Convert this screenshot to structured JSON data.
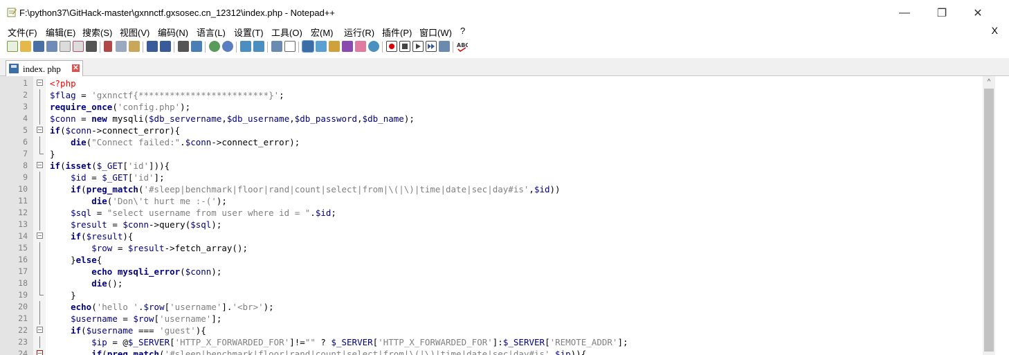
{
  "window": {
    "title": "F:\\python37\\GitHack-master\\gxnnctf.gxsosec.cn_12312\\index.php - Notepad++",
    "minimize": "—",
    "restore": "❐",
    "close": "✕"
  },
  "menu": {
    "items": [
      "文件(F)",
      "编辑(E)",
      "搜索(S)",
      "视图(V)",
      "编码(N)",
      "语言(L)",
      "设置(T)",
      "工具(O)",
      "宏(M)",
      "运行(R)",
      "插件(P)",
      "窗口(W)",
      "?"
    ],
    "close_doc": "X"
  },
  "toolbar": {
    "icons": [
      "new-file",
      "open-file",
      "save",
      "save-all",
      "close",
      "close-all",
      "print",
      "cut",
      "copy",
      "paste",
      "undo",
      "redo",
      "find",
      "replace",
      "zoom-in",
      "zoom-out",
      "sync-vertical",
      "sync-horizontal",
      "word-wrap",
      "show-all-chars",
      "indent-guide",
      "doc-map",
      "function-list",
      "folder-workspace",
      "monitor",
      "record-macro",
      "stop-record",
      "play-macro",
      "run-macro-multiple",
      "save-macro",
      "spell-check"
    ]
  },
  "tab": {
    "label": "index. php",
    "close": "✕"
  },
  "editor": {
    "lines": [
      {
        "n": "1",
        "fold": "box",
        "parts": [
          [
            "r",
            "<?php"
          ]
        ]
      },
      {
        "n": "2",
        "fold": "vline",
        "parts": [
          [
            "v",
            "$flag"
          ],
          [
            "d",
            " = "
          ],
          [
            "s",
            "'gxnnctf{*************************}'"
          ],
          [
            "d",
            ";"
          ]
        ]
      },
      {
        "n": "3",
        "fold": "vline",
        "parts": [
          [
            "k",
            "require_once"
          ],
          [
            "d",
            "("
          ],
          [
            "s",
            "'config.php'"
          ],
          [
            "d",
            ");"
          ]
        ]
      },
      {
        "n": "4",
        "fold": "vline",
        "parts": [
          [
            "v",
            "$conn"
          ],
          [
            "d",
            " = "
          ],
          [
            "k",
            "new"
          ],
          [
            "d",
            " mysqli("
          ],
          [
            "v",
            "$db_servername"
          ],
          [
            "d",
            ","
          ],
          [
            "v",
            "$db_username"
          ],
          [
            "d",
            ","
          ],
          [
            "v",
            "$db_password"
          ],
          [
            "d",
            ","
          ],
          [
            "v",
            "$db_name"
          ],
          [
            "d",
            ");"
          ]
        ]
      },
      {
        "n": "5",
        "fold": "box",
        "parts": [
          [
            "k",
            "if"
          ],
          [
            "d",
            "("
          ],
          [
            "v",
            "$conn"
          ],
          [
            "d",
            "->connect_error){"
          ]
        ]
      },
      {
        "n": "6",
        "fold": "vline",
        "parts": [
          [
            "d",
            "    "
          ],
          [
            "k",
            "die"
          ],
          [
            "d",
            "("
          ],
          [
            "s",
            "\"Connect failed:\""
          ],
          [
            "d",
            "."
          ],
          [
            "v",
            "$conn"
          ],
          [
            "d",
            "->connect_error);"
          ]
        ]
      },
      {
        "n": "7",
        "fold": "end",
        "parts": [
          [
            "d",
            "}"
          ]
        ]
      },
      {
        "n": "8",
        "fold": "box",
        "parts": [
          [
            "k",
            "if"
          ],
          [
            "d",
            "("
          ],
          [
            "k",
            "isset"
          ],
          [
            "d",
            "("
          ],
          [
            "v",
            "$_GET"
          ],
          [
            "d",
            "["
          ],
          [
            "s",
            "'id'"
          ],
          [
            "d",
            "])){"
          ]
        ]
      },
      {
        "n": "9",
        "fold": "vline",
        "parts": [
          [
            "d",
            "    "
          ],
          [
            "v",
            "$id"
          ],
          [
            "d",
            " = "
          ],
          [
            "v",
            "$_GET"
          ],
          [
            "d",
            "["
          ],
          [
            "s",
            "'id'"
          ],
          [
            "d",
            "];"
          ]
        ]
      },
      {
        "n": "10",
        "fold": "vline",
        "parts": [
          [
            "d",
            "    "
          ],
          [
            "k",
            "if"
          ],
          [
            "d",
            "("
          ],
          [
            "k",
            "preg_match"
          ],
          [
            "d",
            "("
          ],
          [
            "s",
            "'#sleep|benchmark|floor|rand|count|select|from|\\(|\\)|time|date|sec|day#is'"
          ],
          [
            "d",
            ","
          ],
          [
            "v",
            "$id"
          ],
          [
            "d",
            "))"
          ]
        ]
      },
      {
        "n": "11",
        "fold": "vline",
        "parts": [
          [
            "d",
            "        "
          ],
          [
            "k",
            "die"
          ],
          [
            "d",
            "("
          ],
          [
            "s",
            "'Don\\'t hurt me :-('"
          ],
          [
            "d",
            ");"
          ]
        ]
      },
      {
        "n": "12",
        "fold": "vline",
        "parts": [
          [
            "d",
            "    "
          ],
          [
            "v",
            "$sql"
          ],
          [
            "d",
            " = "
          ],
          [
            "s",
            "\"select username from user where id = \""
          ],
          [
            "d",
            "."
          ],
          [
            "v",
            "$id"
          ],
          [
            "d",
            ";"
          ]
        ]
      },
      {
        "n": "13",
        "fold": "vline",
        "parts": [
          [
            "d",
            "    "
          ],
          [
            "v",
            "$result"
          ],
          [
            "d",
            " = "
          ],
          [
            "v",
            "$conn"
          ],
          [
            "d",
            "->query("
          ],
          [
            "v",
            "$sql"
          ],
          [
            "d",
            ");"
          ]
        ]
      },
      {
        "n": "14",
        "fold": "box",
        "parts": [
          [
            "d",
            "    "
          ],
          [
            "k",
            "if"
          ],
          [
            "d",
            "("
          ],
          [
            "v",
            "$result"
          ],
          [
            "d",
            "){"
          ]
        ]
      },
      {
        "n": "15",
        "fold": "vline",
        "parts": [
          [
            "d",
            "        "
          ],
          [
            "v",
            "$row"
          ],
          [
            "d",
            " = "
          ],
          [
            "v",
            "$result"
          ],
          [
            "d",
            "->fetch_array();"
          ]
        ]
      },
      {
        "n": "16",
        "fold": "vline",
        "parts": [
          [
            "d",
            "    }"
          ],
          [
            "k",
            "else"
          ],
          [
            "d",
            "{"
          ]
        ]
      },
      {
        "n": "17",
        "fold": "vline",
        "parts": [
          [
            "d",
            "        "
          ],
          [
            "k",
            "echo"
          ],
          [
            "d",
            " "
          ],
          [
            "k",
            "mysqli_error"
          ],
          [
            "d",
            "("
          ],
          [
            "v",
            "$conn"
          ],
          [
            "d",
            ");"
          ]
        ]
      },
      {
        "n": "18",
        "fold": "vline",
        "parts": [
          [
            "d",
            "        "
          ],
          [
            "k",
            "die"
          ],
          [
            "d",
            "();"
          ]
        ]
      },
      {
        "n": "19",
        "fold": "end",
        "parts": [
          [
            "d",
            "    }"
          ]
        ]
      },
      {
        "n": "20",
        "fold": "vline",
        "parts": [
          [
            "d",
            "    "
          ],
          [
            "k",
            "echo"
          ],
          [
            "d",
            "("
          ],
          [
            "s",
            "'hello '"
          ],
          [
            "d",
            "."
          ],
          [
            "v",
            "$row"
          ],
          [
            "d",
            "["
          ],
          [
            "s",
            "'username'"
          ],
          [
            "d",
            "]."
          ],
          [
            "s",
            "'<br>'"
          ],
          [
            "d",
            ");"
          ]
        ]
      },
      {
        "n": "21",
        "fold": "vline",
        "parts": [
          [
            "d",
            "    "
          ],
          [
            "v",
            "$username"
          ],
          [
            "d",
            " = "
          ],
          [
            "v",
            "$row"
          ],
          [
            "d",
            "["
          ],
          [
            "s",
            "'username'"
          ],
          [
            "d",
            "];"
          ]
        ]
      },
      {
        "n": "22",
        "fold": "box",
        "parts": [
          [
            "d",
            "    "
          ],
          [
            "k",
            "if"
          ],
          [
            "d",
            "("
          ],
          [
            "v",
            "$username"
          ],
          [
            "d",
            " === "
          ],
          [
            "s",
            "'guest'"
          ],
          [
            "d",
            "){"
          ]
        ]
      },
      {
        "n": "23",
        "fold": "vline",
        "parts": [
          [
            "d",
            "        "
          ],
          [
            "v",
            "$ip"
          ],
          [
            "d",
            " = @"
          ],
          [
            "v",
            "$_SERVER"
          ],
          [
            "d",
            "["
          ],
          [
            "s",
            "'HTTP_X_FORWARDED_FOR'"
          ],
          [
            "d",
            "]!="
          ],
          [
            "s",
            "\"\""
          ],
          [
            "d",
            " ? "
          ],
          [
            "v",
            "$_SERVER"
          ],
          [
            "d",
            "["
          ],
          [
            "s",
            "'HTTP_X_FORWARDED_FOR'"
          ],
          [
            "d",
            "]:"
          ],
          [
            "v",
            "$_SERVER"
          ],
          [
            "d",
            "["
          ],
          [
            "s",
            "'REMOTE_ADDR'"
          ],
          [
            "d",
            "];"
          ]
        ]
      },
      {
        "n": "24",
        "fold": "boxred",
        "parts": [
          [
            "d",
            "        "
          ],
          [
            "k",
            "if"
          ],
          [
            "d",
            "("
          ],
          [
            "k",
            "preg_match"
          ],
          [
            "d",
            "("
          ],
          [
            "s",
            "'#sleep|benchmark|floor|rand|count|select|from|\\(|\\)|time|date|sec|day#is'"
          ],
          [
            "d",
            ","
          ],
          [
            "v",
            "$ip"
          ],
          [
            "d",
            "))"
          ],
          [
            "d",
            "{"
          ]
        ]
      }
    ]
  },
  "scrollbar": {
    "up_arrow": "^"
  }
}
